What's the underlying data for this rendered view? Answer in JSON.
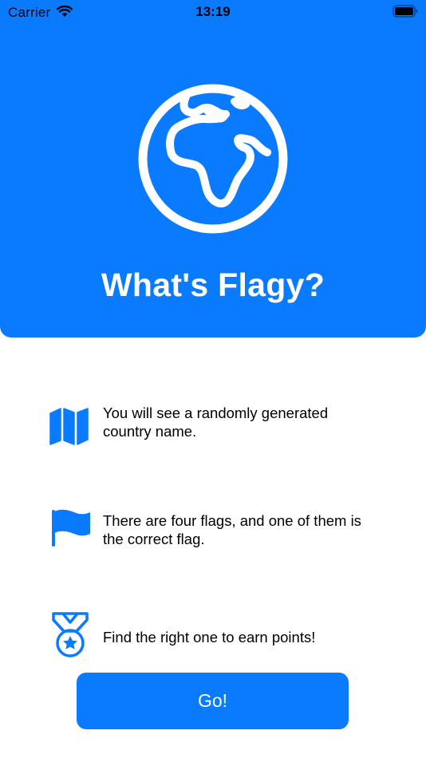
{
  "status_bar": {
    "carrier": "Carrier",
    "time": "13:19",
    "wifi_icon": "wifi-icon",
    "battery_icon": "battery-icon"
  },
  "hero": {
    "icon": "globe-africa-icon",
    "title": "What's Flagy?",
    "background_color": "#0A7BFF"
  },
  "features": [
    {
      "icon": "map-icon",
      "text_line1": "You will see a randomly generated",
      "text_line2": "country name."
    },
    {
      "icon": "flag-icon",
      "text_line1": "There are four flags, and one of them is",
      "text_line2": "the correct flag."
    },
    {
      "icon": "medal-icon",
      "text_line1": "Find the right one to earn points!",
      "text_line2": ""
    }
  ],
  "go_button": {
    "label": "Go!"
  },
  "colors": {
    "accent": "#0A7BFF",
    "background": "#FFFFFF",
    "text": "#000000"
  }
}
